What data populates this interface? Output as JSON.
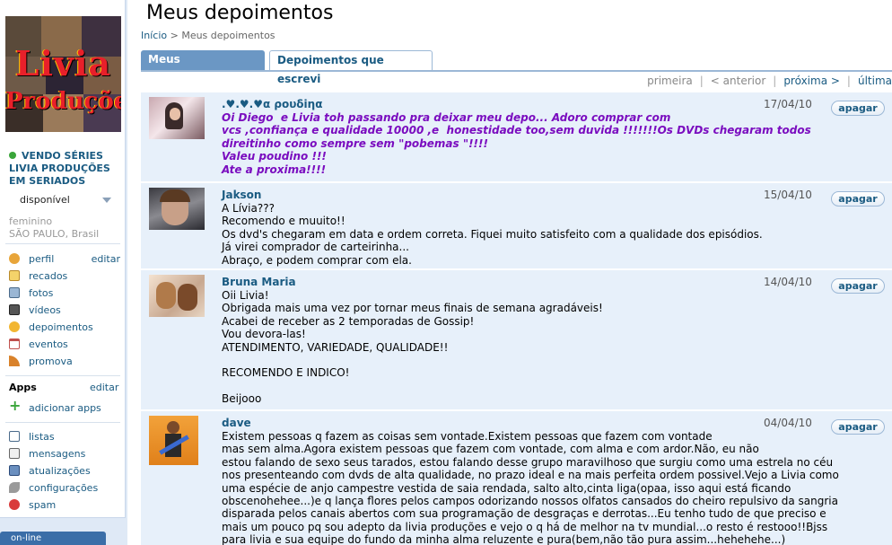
{
  "sidebar": {
    "profile_name": "VENDO SÉRIES LIVIA PRODUÇÕES EM SERIADOS",
    "photo_logo": [
      "Livia",
      "Produções"
    ],
    "status": "disponível",
    "gender": "feminino",
    "location": "SÃO PAULO, Brasil",
    "nav": [
      {
        "label": "perfil",
        "icon": "user-icon",
        "edit": "editar"
      },
      {
        "label": "recados",
        "icon": "notepad-icon"
      },
      {
        "label": "fotos",
        "icon": "photo-icon"
      },
      {
        "label": "vídeos",
        "icon": "film-icon"
      },
      {
        "label": "depoimentos",
        "icon": "sun-icon"
      },
      {
        "label": "eventos",
        "icon": "calendar-icon"
      },
      {
        "label": "promova",
        "icon": "broadcast-icon"
      }
    ],
    "apps_header": "Apps",
    "apps_edit": "editar",
    "add_apps": "adicionar apps",
    "bottom_nav": [
      {
        "label": "listas",
        "icon": "list-icon"
      },
      {
        "label": "mensagens",
        "icon": "envelope-icon"
      },
      {
        "label": "atualizações",
        "icon": "updates-icon"
      },
      {
        "label": "configurações",
        "icon": "wrench-icon"
      },
      {
        "label": "spam",
        "icon": "spam-icon"
      }
    ],
    "online_label": "on-line"
  },
  "main": {
    "title": "Meus depoimentos",
    "breadcrumb": {
      "home": "Início",
      "sep": " > ",
      "current": "Meus depoimentos"
    },
    "tabs": [
      {
        "label": "Meus depoimentos",
        "active": true
      },
      {
        "label": "Depoimentos que escrevi",
        "active": false
      }
    ],
    "pager": {
      "first": "primeira",
      "prev": "< anterior",
      "next": "próxima >",
      "last": "última"
    },
    "delete_label": "apagar",
    "entries": [
      {
        "author": ".♥.♥.♥α ρουδiηα",
        "date": "17/04/10",
        "body": "Oi Diego  e Livia toh passando pra deixar meu depo... Adoro comprar com\nvcs ,confiança e qualidade 10000 ,e  honestidade too,sem duvida !!!!!!!Os DVDs chegaram todos\ndireitinho como sempre sem \"pobemas \"!!!!\nValeu poudino !!!\nAte a proxima!!!!"
      },
      {
        "author": "Jakson",
        "date": "15/04/10",
        "body": "A Lívia???\nRecomendo e muuito!!\nOs dvd's chegaram em data e ordem correta. Fiquei muito satisfeito com a qualidade dos episódios.\nJá virei comprador de carteirinha...\nAbraço, e podem comprar com ela."
      },
      {
        "author": "Bruna Maria",
        "date": "14/04/10",
        "body": "Oii Livia!\nObrigada mais uma vez por tornar meus finais de semana agradáveis!\nAcabei de receber as 2 temporadas de Gossip!\nVou devora-las!\nATENDIMENTO, VARIEDADE, QUALIDADE!!\n\nRECOMENDO E INDICO!\n\nBeijooo"
      },
      {
        "author": "dave",
        "date": "04/04/10",
        "body": "Existem pessoas q fazem as coisas sem vontade.Existem pessoas que fazem com vontade\nmas sem alma.Agora existem pessoas que fazem com vontade, com alma e com ardor.Não, eu não\nestou falando de sexo seus tarados, estou falando desse grupo maravilhoso que surgiu como uma estrela no céu\nnos presenteando com dvds de alta qualidade, no prazo ideal e na mais perfeita ordem possivel.Vejo a Livia como\numa espécie de anjo campestre vestida de saia rendada, salto alto,cinta liga(opaa, isso aqui está ficando\nobscenohehee...)e q lança flores pelos campos odorizando nossos olfatos cansados do cheiro repulsivo da sangria\ndisparada pelos canais abertos com sua programação de desgraças e derrotas...Eu tenho tudo de que preciso e\nmais um pouco pq sou adepto da livia produções e vejo o q há de melhor na tv mundial...o resto é restooo!!Bjss\npara livia e sua equipe do fundo da minha alma reluzente e pura(bem,não tão pura assim...hehehehe...)"
      }
    ]
  },
  "colors": {
    "link": "#1a5b82",
    "tab_active": "#6b97c4",
    "entry_bg": "#e7f0fa",
    "first_entry_text": "#7a0cbf"
  }
}
